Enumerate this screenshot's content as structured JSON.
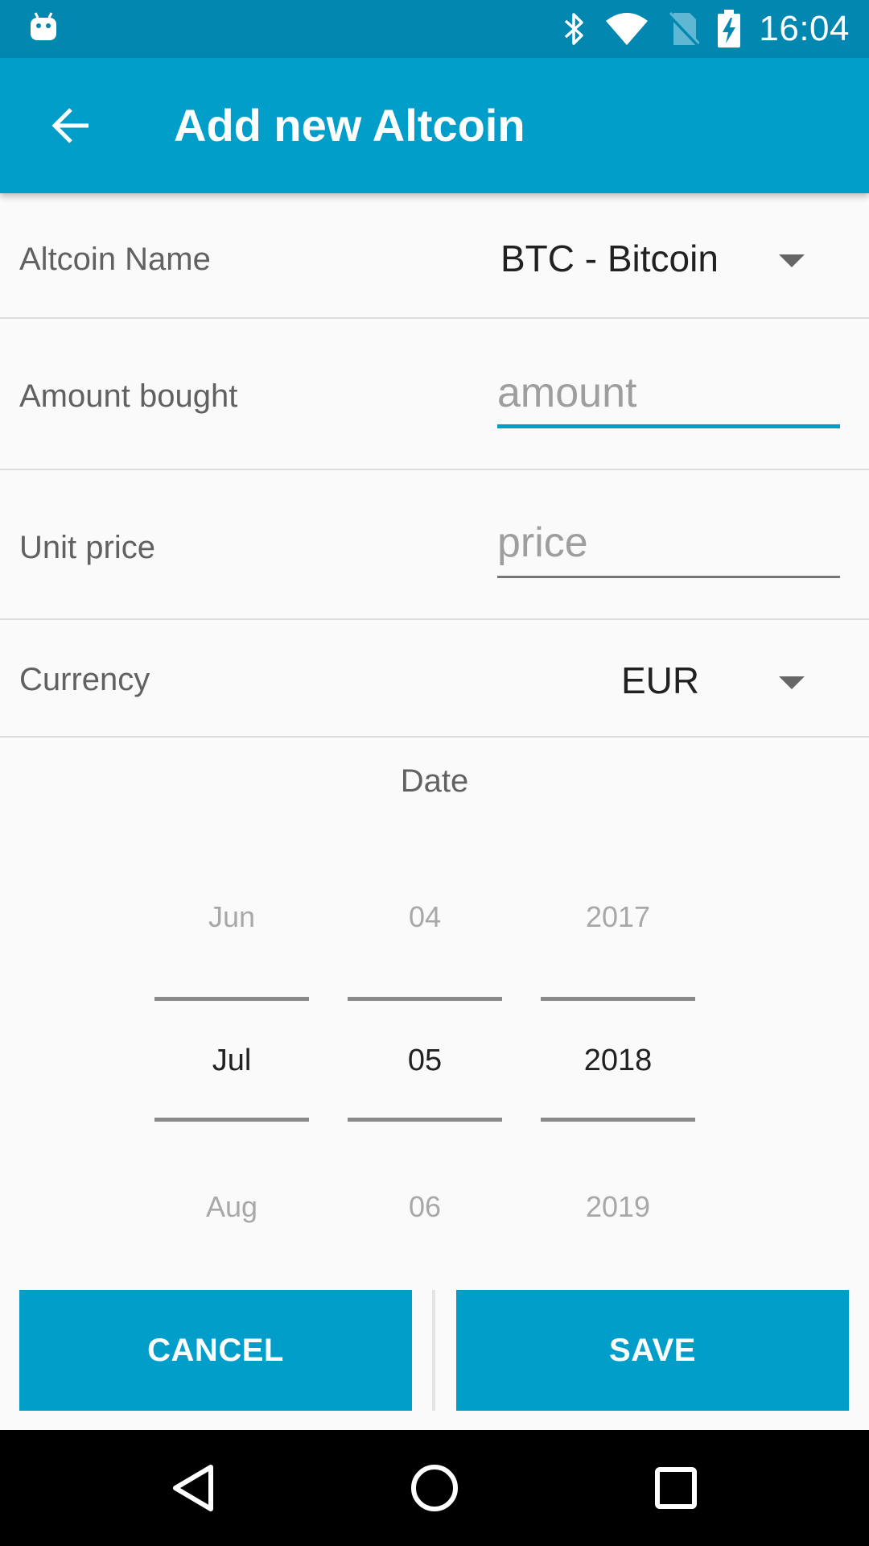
{
  "status_bar": {
    "time": "16:04",
    "icons": [
      "android-icon",
      "bluetooth-icon",
      "wifi-icon",
      "no-sim-icon",
      "battery-charging-icon"
    ]
  },
  "app_bar": {
    "title": "Add new Altcoin",
    "back_icon": "arrow-back-icon"
  },
  "form": {
    "altcoin_name": {
      "label": "Altcoin Name",
      "value": "BTC - Bitcoin"
    },
    "amount": {
      "label": "Amount bought",
      "placeholder": "amount"
    },
    "unit_price": {
      "label": "Unit price",
      "placeholder": "price"
    },
    "currency": {
      "label": "Currency",
      "value": "EUR"
    }
  },
  "date_picker": {
    "label": "Date",
    "month": {
      "prev": "Jun",
      "selected": "Jul",
      "next": "Aug"
    },
    "day": {
      "prev": "04",
      "selected": "05",
      "next": "06"
    },
    "year": {
      "prev": "2017",
      "selected": "2018",
      "next": "2019"
    }
  },
  "actions": {
    "cancel_label": "CANCEL",
    "save_label": "SAVE"
  },
  "colors": {
    "primary": "#009ec9",
    "primary_dark": "#0288b0",
    "accent_underline": "#009ec9"
  }
}
